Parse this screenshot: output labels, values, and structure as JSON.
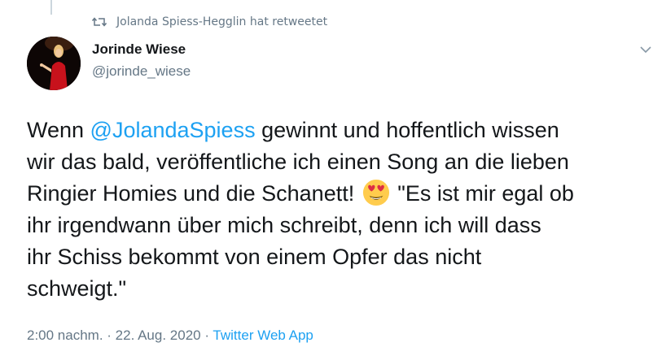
{
  "retweet": {
    "icon": "retweet-icon",
    "text": "Jolanda Spiess-Hegglin hat retweetet"
  },
  "author": {
    "display_name": "Jorinde Wiese",
    "handle": "@jorinde_wiese",
    "avatar": "avatar"
  },
  "menu": {
    "icon": "chevron-down-icon"
  },
  "tweet": {
    "lines": [
      {
        "before": "Wenn ",
        "mention": "@JolandaSpiess",
        "after": " gewinnt und hoffentlich wissen"
      },
      {
        "text": "wir das bald, veröffentliche ich einen Song an die lieben"
      },
      {
        "before": "Ringier Homies und die Schanett! ",
        "emoji": "heart-eyes-emoji",
        "after": " \"Es ist mir egal ob"
      },
      {
        "text": "ihr irgendwann über mich schreibt, denn ich will dass"
      },
      {
        "text": "ihr Schiss bekommt von einem Opfer das nicht"
      },
      {
        "text": "schweigt.\""
      }
    ]
  },
  "meta": {
    "time": "2:00 nachm.",
    "separator1": " · ",
    "date": "22. Aug. 2020",
    "separator2": " · ",
    "source": "Twitter Web App"
  },
  "colors": {
    "link": "#1da1f2",
    "secondary_text": "#657786",
    "primary_text": "#14171a",
    "emoji_yellow": "#ffcc4d",
    "heart_red": "#dd2e44"
  }
}
